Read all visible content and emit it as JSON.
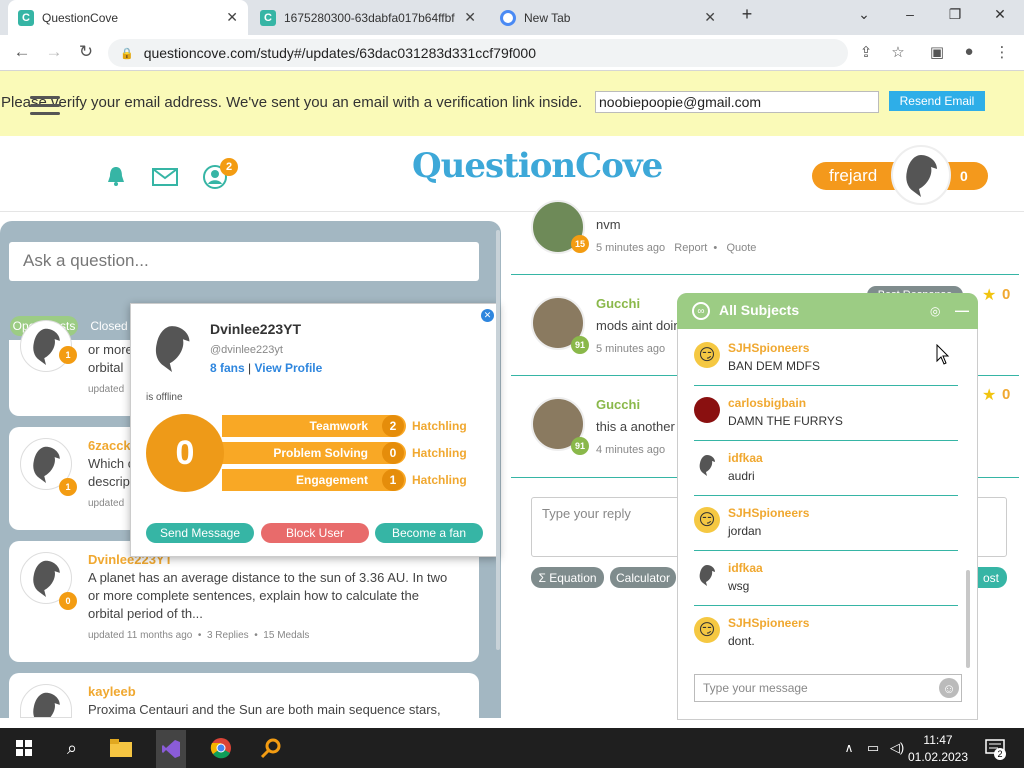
{
  "browser": {
    "tabs": [
      {
        "title": "QuestionCove",
        "favicon": "questioncove-favicon",
        "active": true
      },
      {
        "title": "1675280300-63dabfa017b64ffbf",
        "favicon": "questioncove-favicon",
        "active": false
      },
      {
        "title": "New Tab",
        "favicon": "chrome-icon",
        "active": false
      }
    ],
    "url": "questioncove.com/study#/updates/63dac031283d331ccf79f000"
  },
  "verify": {
    "message": "Please verify your email address. We've sent you an email with a verification link inside.",
    "email": "noobiepoopie@gmail.com",
    "resend_label": "Resend Email"
  },
  "header": {
    "logo": "QuestionCove",
    "notification_count": "2",
    "username": "frejard",
    "score": "0"
  },
  "left": {
    "ask_placeholder": "Ask a question...",
    "filters": [
      "Open Posts",
      "Closed"
    ],
    "questions": [
      {
        "name": "",
        "text_line1": "or more",
        "text_line2": "orbital",
        "meta": "updated",
        "badge": "1"
      },
      {
        "name": "6zacck",
        "text_line1": "Which c",
        "text_line2": "descrip",
        "meta": "updated",
        "badge": "1"
      },
      {
        "name": "Dvinlee223YT",
        "text_line1": "A planet has an average distance to the sun of 3.36 AU. In two",
        "text_line2": "or more complete sentences, explain how to calculate the",
        "text_line3": "orbital period of th...",
        "meta": "updated 11 months ago",
        "replies": "3 Replies",
        "medals": "15 Medals",
        "badge": "0"
      },
      {
        "name": "kayleeb",
        "text_line1": "Proxima Centauri and the Sun are both main sequence stars,",
        "badge": ""
      }
    ]
  },
  "profile_popup": {
    "username": "Dvinlee223YT",
    "handle": "@dvinlee223yt",
    "fans": "8 fans",
    "separator": "|",
    "view_profile": "View Profile",
    "status": "is offline",
    "score": "0",
    "stats": [
      {
        "label": "Teamwork",
        "value": "2",
        "rank": "Hatchling"
      },
      {
        "label": "Problem Solving",
        "value": "0",
        "rank": "Hatchling"
      },
      {
        "label": "Engagement",
        "value": "1",
        "rank": "Hatchling"
      }
    ],
    "buttons": {
      "send": "Send Message",
      "block": "Block User",
      "fan": "Become a fan"
    }
  },
  "replies": {
    "items": [
      {
        "name": "",
        "text": "nvm",
        "time": "5 minutes ago",
        "report": "Report",
        "quote": "Quote",
        "badge": "15",
        "badge_color": "#f39c12"
      },
      {
        "name": "Gucchi",
        "text": "mods aint doin",
        "time": "5 minutes ago",
        "badge": "91",
        "badge_color": "#8ab84a",
        "medal_count": "0"
      },
      {
        "name": "Gucchi",
        "text": "this a another",
        "time": "4 minutes ago",
        "badge": "91",
        "badge_color": "#8ab84a",
        "medal_count": "0"
      }
    ],
    "best_response": "Best Response",
    "reply_placeholder": "Type your reply",
    "tools": [
      "Σ Equation",
      "Calculator"
    ],
    "post_label": "ost"
  },
  "chat": {
    "title": "All Subjects",
    "messages": [
      {
        "name": "SJHSpioneers",
        "text": "BAN DEM MDFS",
        "avatar": "smiley-icon"
      },
      {
        "name": "carlosbigbain",
        "text": "DAMN THE FURRYS",
        "avatar": "red-avatar"
      },
      {
        "name": "idfkaa",
        "text": "audri",
        "avatar": "dolphin-icon"
      },
      {
        "name": "SJHSpioneers",
        "text": "jordan",
        "avatar": "smiley-icon"
      },
      {
        "name": "idfkaa",
        "text": "wsg",
        "avatar": "dolphin-icon"
      },
      {
        "name": "SJHSpioneers",
        "text": "dont.",
        "avatar": "smiley-icon"
      }
    ],
    "input_placeholder": "Type your message"
  },
  "taskbar": {
    "time": "11:47",
    "date": "01.02.2023"
  },
  "colors": {
    "teal": "#36b5a5",
    "orange": "#f9a825",
    "banner": "#fafab8",
    "chat_header": "#9ccc84",
    "left_bg": "#a3b7c2"
  }
}
